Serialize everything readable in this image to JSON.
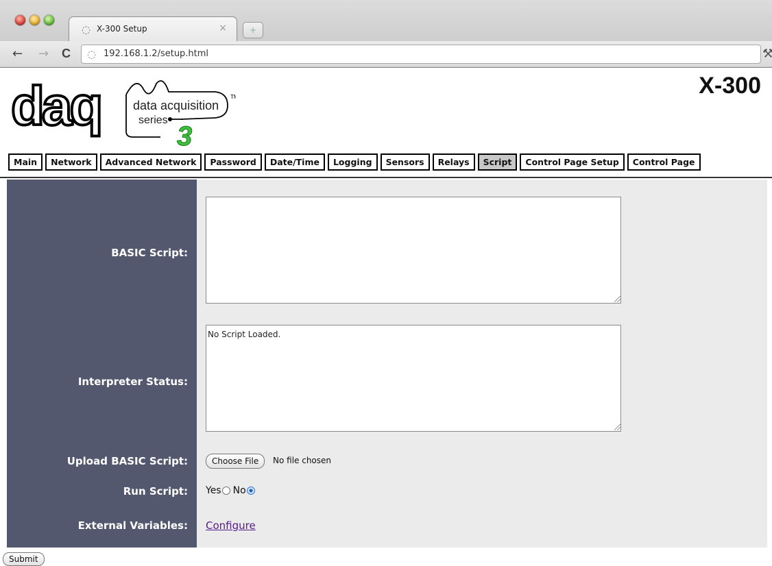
{
  "browser": {
    "tab_title": "X-300 Setup",
    "tab_close": "×",
    "new_tab": "+",
    "url": "192.168.1.2/setup.html",
    "back": "←",
    "forward": "→",
    "reload": "C",
    "wrench": "🔧"
  },
  "header": {
    "model": "X-300",
    "logo": {
      "brand": "daq",
      "line1": "data acquisition",
      "line2": "series",
      "numeral": "3",
      "tm": "TM"
    }
  },
  "nav": {
    "tabs": [
      {
        "label": "Main"
      },
      {
        "label": "Network"
      },
      {
        "label": "Advanced Network"
      },
      {
        "label": "Password"
      },
      {
        "label": "Date/Time"
      },
      {
        "label": "Logging"
      },
      {
        "label": "Sensors"
      },
      {
        "label": "Relays"
      },
      {
        "label": "Script",
        "active": true
      },
      {
        "label": "Control Page Setup"
      },
      {
        "label": "Control Page"
      }
    ]
  },
  "form": {
    "basic_script_label": "BASIC Script:",
    "basic_script_value": "",
    "interpreter_status_label": "Interpreter Status:",
    "interpreter_status_value": "No Script Loaded.",
    "upload_label": "Upload BASIC Script:",
    "choose_file": "Choose File",
    "no_file": "No file chosen",
    "run_label": "Run Script:",
    "run_yes": "Yes",
    "run_no": "No",
    "run_selected": "No",
    "external_label": "External Variables:",
    "configure_link": "Configure",
    "submit": "Submit"
  },
  "colors": {
    "label_panel": "#53586f",
    "field_panel": "#ebebeb",
    "active_tab": "#c8c8c8",
    "link": "#551a8b",
    "logo_green": "#3cbf3c"
  }
}
